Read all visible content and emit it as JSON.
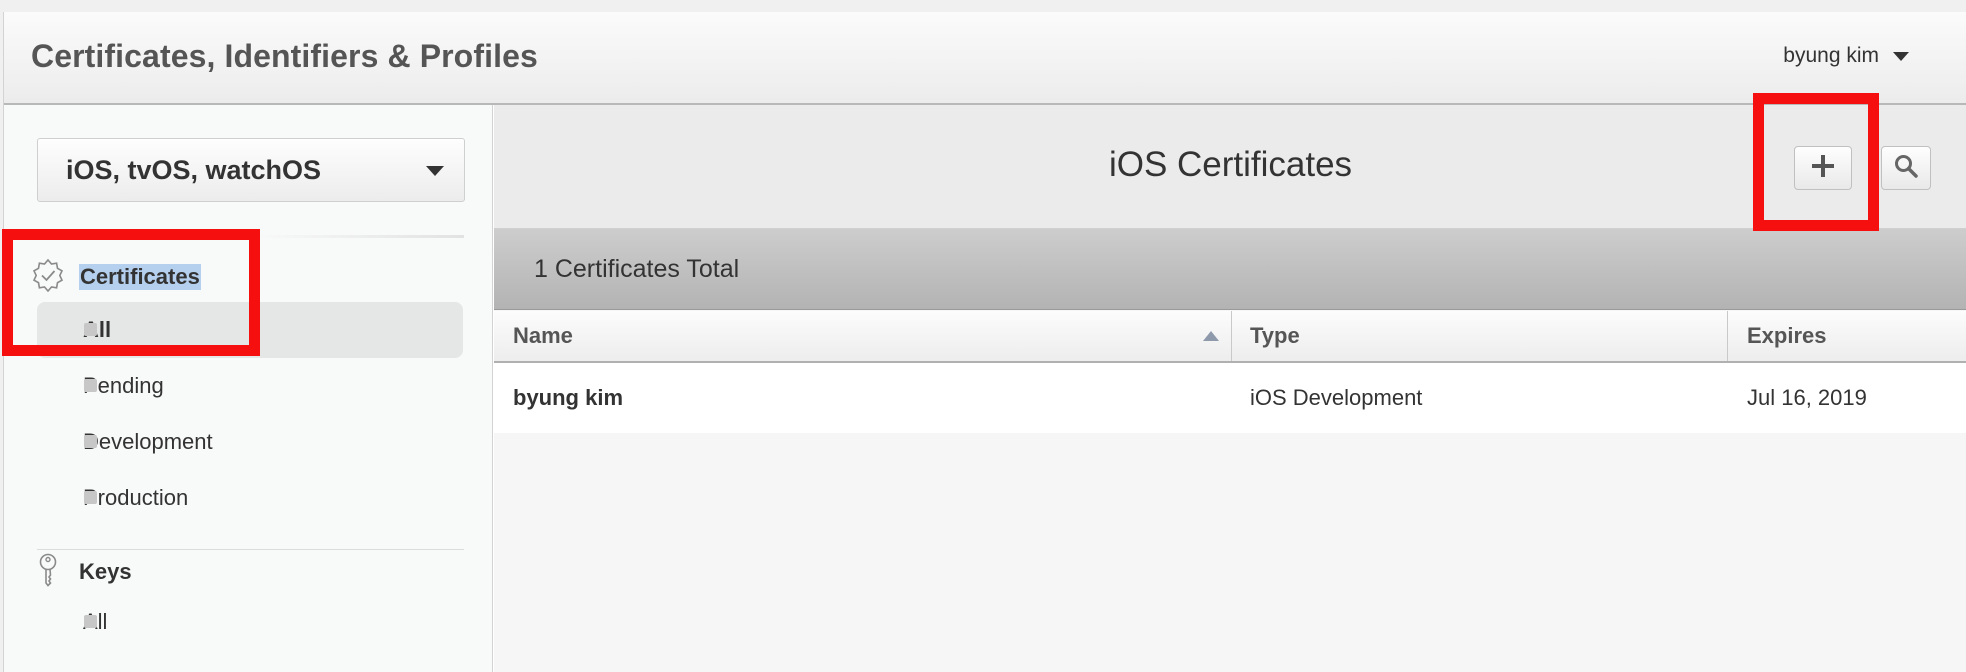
{
  "header": {
    "title": "Certificates, Identifiers & Profiles",
    "user_name": "byung kim"
  },
  "sidebar": {
    "platform": "iOS, tvOS, watchOS",
    "sections": [
      {
        "label": "Certificates",
        "icon": "certificate-badge-icon",
        "items": [
          {
            "label": "All",
            "active": true
          },
          {
            "label": "Pending"
          },
          {
            "label": "Development"
          },
          {
            "label": "Production"
          }
        ]
      },
      {
        "label": "Keys",
        "icon": "key-icon",
        "items": [
          {
            "label": "All"
          }
        ]
      }
    ]
  },
  "main": {
    "title": "iOS Certificates",
    "add_icon": "plus-icon",
    "search_icon": "search-icon",
    "count_text": "1 Certificates Total",
    "columns": [
      "Name",
      "Type",
      "Expires"
    ],
    "sort_column": "Name",
    "rows": [
      {
        "name": "byung kim",
        "type": "iOS Development",
        "expires": "Jul 16, 2019"
      }
    ]
  },
  "annotations": {
    "color": "#f50f0f"
  }
}
